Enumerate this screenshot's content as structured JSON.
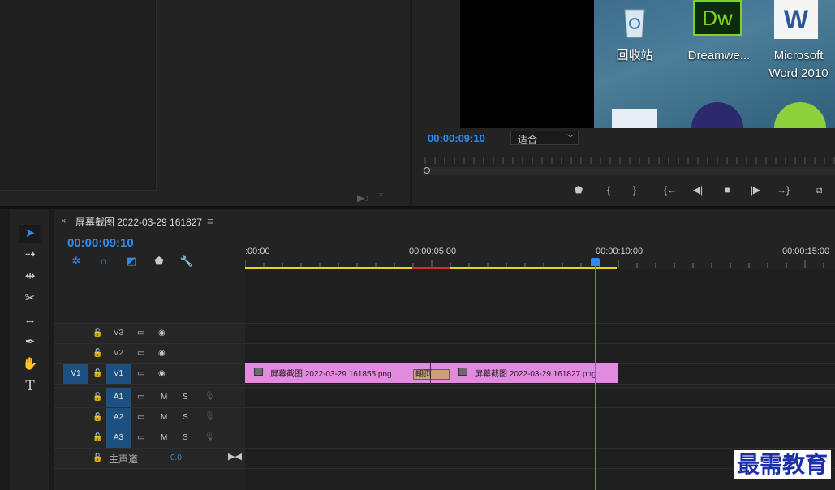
{
  "program": {
    "timecode": "00:00:09:10",
    "fit_label": "适合",
    "desktop_icons": [
      {
        "label": "回收站",
        "icon": "recycle-bin-icon"
      },
      {
        "label": "Dreamwe...",
        "icon": "dreamweaver-icon",
        "badge": "Dw"
      },
      {
        "label": "Microsoft Word 2010",
        "icon": "word-icon",
        "badge": "W"
      }
    ],
    "transport": [
      "marker-icon",
      "mark-in-icon",
      "mark-out-icon",
      "go-to-in-icon",
      "step-back-icon",
      "stop-icon",
      "step-forward-icon",
      "go-to-out-icon",
      "export-frame-icon"
    ]
  },
  "timeline": {
    "tab_title": "屏幕截图 2022-03-29 161827",
    "timecode": "00:00:09:10",
    "ruler_labels": [
      ":00:00",
      "00:00:05:00",
      "00:00:10:00",
      "00:00:15:00"
    ],
    "tracks": [
      {
        "name": "V3",
        "kind": "video"
      },
      {
        "name": "V2",
        "kind": "video"
      },
      {
        "name": "V1",
        "kind": "video",
        "source": "V1"
      },
      {
        "name": "A1",
        "kind": "audio",
        "m": "M",
        "s": "S"
      },
      {
        "name": "A2",
        "kind": "audio",
        "m": "M",
        "s": "S"
      },
      {
        "name": "A3",
        "kind": "audio",
        "m": "M",
        "s": "S"
      }
    ],
    "clips": [
      {
        "name": "屏幕截图 2022-03-29 161855.png"
      },
      {
        "name": "屏幕截图 2022-03-29 161827.png"
      }
    ],
    "transition_label": "翻页",
    "master": {
      "label": "主声道",
      "value": "0.0"
    }
  },
  "watermark": "最需教育",
  "colors": {
    "accent": "#2d8ceb",
    "clip": "#e28ae0",
    "workarea": "#e6d51b"
  }
}
